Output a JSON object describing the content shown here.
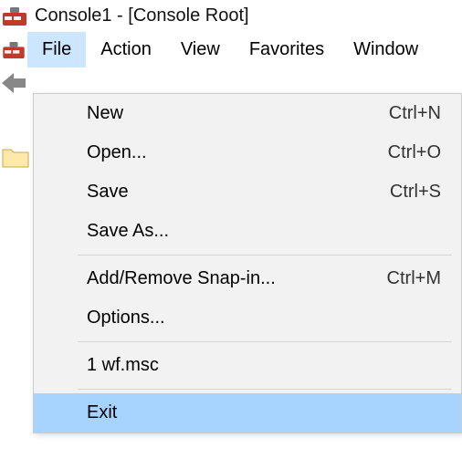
{
  "window": {
    "title": "Console1 - [Console Root]"
  },
  "menubar": {
    "items": [
      {
        "label": "File",
        "active": true
      },
      {
        "label": "Action",
        "active": false
      },
      {
        "label": "View",
        "active": false
      },
      {
        "label": "Favorites",
        "active": false
      },
      {
        "label": "Window",
        "active": false
      }
    ]
  },
  "file_menu": {
    "items": [
      {
        "label": "New",
        "shortcut": "Ctrl+N"
      },
      {
        "label": "Open...",
        "shortcut": "Ctrl+O"
      },
      {
        "label": "Save",
        "shortcut": "Ctrl+S"
      },
      {
        "label": "Save As...",
        "shortcut": ""
      },
      {
        "sep": true
      },
      {
        "label": "Add/Remove Snap-in...",
        "shortcut": "Ctrl+M"
      },
      {
        "label": "Options...",
        "shortcut": ""
      },
      {
        "sep": true
      },
      {
        "label": "1 wf.msc",
        "shortcut": ""
      },
      {
        "sep": true
      },
      {
        "label": "Exit",
        "shortcut": "",
        "highlight": true
      }
    ]
  }
}
